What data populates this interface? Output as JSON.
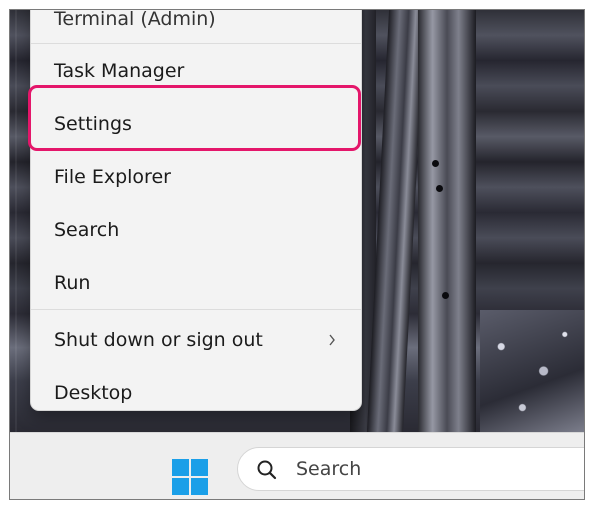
{
  "context_menu": {
    "partial_item": "Terminal (Admin)",
    "items": [
      {
        "label": "Task Manager"
      },
      {
        "label": "Settings",
        "highlighted": true
      },
      {
        "label": "File Explorer"
      },
      {
        "label": "Search"
      },
      {
        "label": "Run"
      },
      {
        "label": "Shut down or sign out",
        "has_submenu": true
      },
      {
        "label": "Desktop"
      }
    ],
    "highlight_color": "#e4166a"
  },
  "taskbar": {
    "start_icon": "windows-logo-icon",
    "search": {
      "label": "Search",
      "icon": "magnifier-icon"
    },
    "accent_color": "#1a9fe8"
  }
}
